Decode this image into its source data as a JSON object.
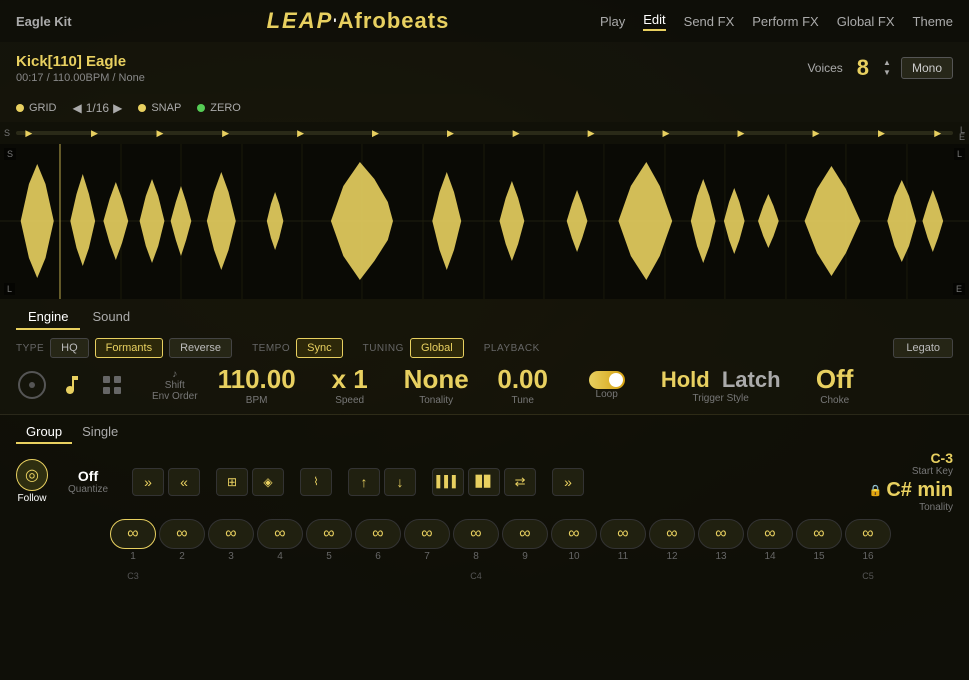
{
  "app": {
    "brand_left": "Eagle Kit",
    "brand_leap": "LEAP",
    "brand_apostrophe": "'",
    "brand_afrobeats": "Afrobeats"
  },
  "nav": {
    "links": [
      "Play",
      "Edit",
      "Send FX",
      "Perform FX",
      "Global FX",
      "Theme"
    ],
    "active": "Edit"
  },
  "header": {
    "sample_title": "Kick[110] Eagle",
    "sample_meta": "00:17 / 110.00BPM / None",
    "voices_label": "Voices",
    "voices_num": "8",
    "mono_btn": "Mono"
  },
  "grid": {
    "grid_label": "GRID",
    "grid_value": "1/16",
    "snap_label": "SNAP",
    "zero_label": "ZERO"
  },
  "engine": {
    "tabs": [
      "Engine",
      "Sound"
    ],
    "active_tab": "Engine",
    "type_label": "TYPE",
    "hq_btn": "HQ",
    "formants_btn": "Formants",
    "reverse_btn": "Reverse",
    "tempo_label": "TEMPO",
    "sync_btn": "Sync",
    "tuning_label": "TUNING",
    "global_btn": "Global",
    "playback_label": "PLAYBACK",
    "legato_btn": "Legato",
    "bpm_value": "110.00",
    "bpm_label": "BPM",
    "speed_value": "x 1",
    "speed_label": "Speed",
    "tonality_value": "None",
    "tonality_label": "Tonality",
    "tune_value": "0.00",
    "tune_label": "Tune",
    "loop_label": "Loop",
    "trigger_style_value1": "Hold",
    "trigger_style_value2": "Latch",
    "trigger_style_label": "Trigger Style",
    "choke_value": "Off",
    "choke_label": "Choke"
  },
  "bottom": {
    "group_tabs": [
      "Group",
      "Single"
    ],
    "active_tab": "Group",
    "start_key_label": "Start Key",
    "start_key_value": "C-3",
    "tonality_value": "C# min",
    "tonality_label": "Tonality",
    "follow_label": "Follow",
    "quantize_value": "Off",
    "quantize_label": "Quantize"
  },
  "pads": {
    "items": [
      {
        "num": "1",
        "note": "C3"
      },
      {
        "num": "2",
        "note": ""
      },
      {
        "num": "3",
        "note": ""
      },
      {
        "num": "4",
        "note": ""
      },
      {
        "num": "5",
        "note": ""
      },
      {
        "num": "6",
        "note": ""
      },
      {
        "num": "7",
        "note": ""
      },
      {
        "num": "8",
        "note": "C4"
      },
      {
        "num": "9",
        "note": ""
      },
      {
        "num": "10",
        "note": ""
      },
      {
        "num": "11",
        "note": ""
      },
      {
        "num": "12",
        "note": ""
      },
      {
        "num": "13",
        "note": ""
      },
      {
        "num": "14",
        "note": ""
      },
      {
        "num": "15",
        "note": ""
      },
      {
        "num": "16",
        "note": "C5"
      }
    ],
    "note_labels": {
      "1": "C3",
      "8": "C4",
      "16": "C5"
    }
  },
  "icons": {
    "melody": "♪",
    "grid": "⊟",
    "shift_label": "Shift",
    "env_order_label": "Env Order",
    "loop_on": "⟳",
    "rewind": "⏮",
    "forward": "⏭",
    "up": "↑",
    "down": "↓",
    "bars1": "▌▌▌",
    "bars2": "▊▊",
    "arrows": "⇄",
    "right_arrows": "»",
    "infinity": "∞",
    "follow": "◎"
  }
}
